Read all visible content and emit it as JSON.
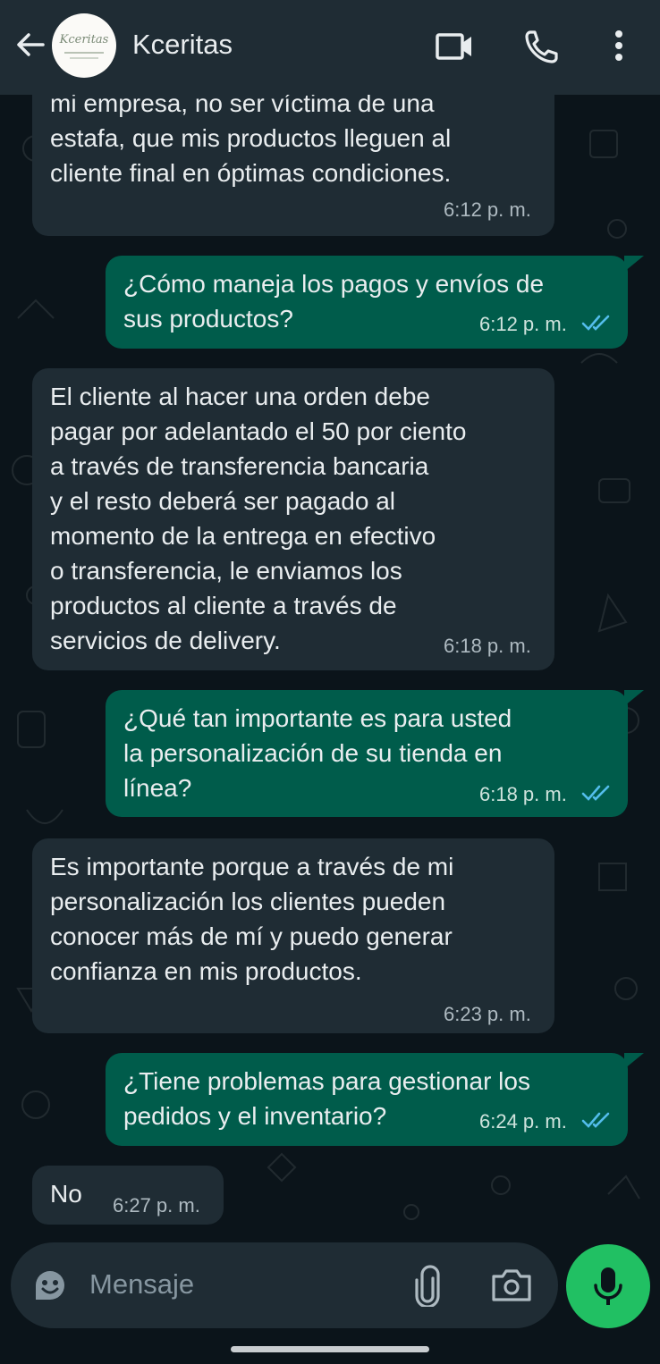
{
  "header": {
    "contact_name": "Kceritas",
    "avatar_text": "Kceritas",
    "back_icon": "arrow-left-icon",
    "video_icon": "video-camera-icon",
    "call_icon": "phone-icon",
    "menu_icon": "vertical-dots-icon"
  },
  "messages": [
    {
      "direction": "in",
      "lines": [
        "mi empresa, no ser víctima de una",
        "estafa, que mis productos lleguen al",
        "cliente final en óptimas condiciones."
      ],
      "time": "6:12 p. m."
    },
    {
      "direction": "out",
      "lines": [
        "¿Cómo maneja los pagos y envíos de",
        "sus productos?"
      ],
      "time": "6:12 p. m.",
      "status": "read"
    },
    {
      "direction": "in",
      "lines": [
        "El cliente al hacer una orden debe",
        "pagar por adelantado el 50 por ciento",
        "a través de transferencia bancaria",
        "y el resto deberá ser pagado al",
        "momento de la entrega en efectivo",
        "o transferencia, le enviamos los",
        "productos al cliente a través de",
        "servicios de delivery."
      ],
      "time": "6:18 p. m."
    },
    {
      "direction": "out",
      "lines": [
        "¿Qué tan importante es para usted",
        "la personalización de su tienda en",
        "línea?"
      ],
      "time": "6:18 p. m.",
      "status": "read"
    },
    {
      "direction": "in",
      "lines": [
        "Es importante porque a través de mi",
        "personalización los clientes pueden",
        "conocer más de mí y puedo generar",
        "confianza en mis productos."
      ],
      "time": "6:23 p. m."
    },
    {
      "direction": "out",
      "lines": [
        "¿Tiene problemas para gestionar los",
        "pedidos y el inventario?"
      ],
      "time": "6:24 p. m.",
      "status": "read"
    },
    {
      "direction": "in",
      "lines": [
        "No"
      ],
      "time": "6:27 p. m."
    }
  ],
  "composer": {
    "placeholder": "Mensaje",
    "emoji_icon": "sticker-emoji-icon",
    "attach_icon": "paperclip-icon",
    "camera_icon": "camera-icon",
    "mic_icon": "microphone-icon"
  },
  "colors": {
    "header_bg": "#1f2c34",
    "chat_bg": "#0b141a",
    "incoming_bubble": "#1f2c34",
    "outgoing_bubble": "#005c4b",
    "read_ticks": "#53bdeb",
    "mic_button": "#21c063"
  }
}
